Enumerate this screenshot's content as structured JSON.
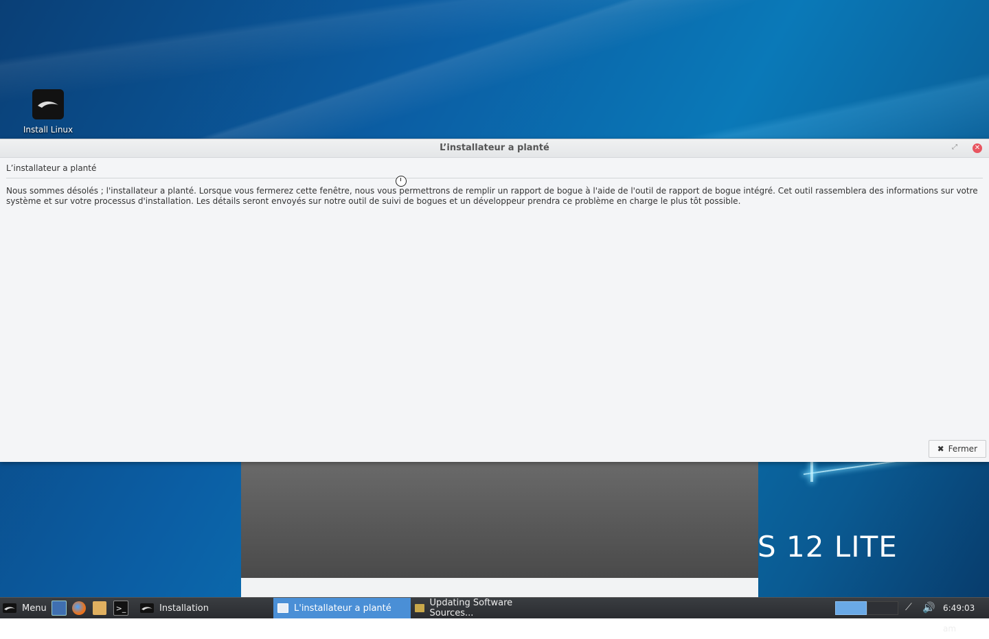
{
  "desktop": {
    "icon_label": "Install Linux",
    "brand_text": "S 12 LITE"
  },
  "dialog": {
    "title": "L’installateur a planté",
    "heading": "L’installateur a planté",
    "message": "Nous sommes désolés ; l'installateur a planté. Lorsque vous fermerez cette fenêtre, nous vous permettrons de remplir un rapport de bogue à l'aide de l'outil de rapport de bogue intégré. Cet outil rassemblera des informations sur votre système et sur votre processus d'installation. Les détails seront envoyés sur notre outil de suivi de bogues et un développeur prendra ce problème en charge le plus tôt possible.",
    "close_button_label": "Fermer"
  },
  "taskbar": {
    "menu_label": "Menu",
    "tasks": [
      {
        "label": "Installation"
      },
      {
        "label": "L'installateur a planté"
      },
      {
        "label": "Updating Software Sources..."
      }
    ],
    "clock": "6:49:03 am"
  },
  "colors": {
    "accent": "#4a8fd6",
    "close": "#e85560"
  }
}
